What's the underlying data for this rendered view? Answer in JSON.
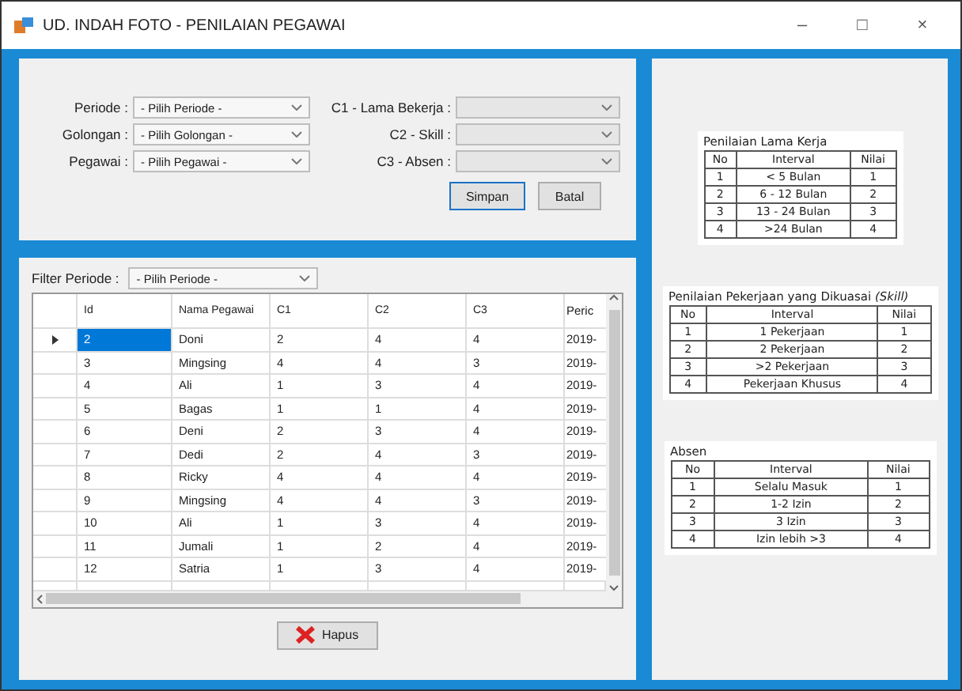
{
  "window": {
    "title": "UD. INDAH FOTO - PENILAIAN PEGAWAI",
    "controls": [
      "–",
      "□",
      "×"
    ]
  },
  "form": {
    "left_fields": [
      {
        "label": "Periode :",
        "value": "- Pilih Periode -"
      },
      {
        "label": "Golongan :",
        "value": "- Pilih Golongan -"
      },
      {
        "label": "Pegawai :",
        "value": "- Pilih Pegawai -"
      }
    ],
    "right_fields": [
      {
        "label": "C1 - Lama Bekerja :"
      },
      {
        "label": "C2 - Skill :"
      },
      {
        "label": "C3 - Absen :"
      }
    ],
    "buttons": [
      {
        "label": "Simpan",
        "focused": true
      },
      {
        "label": "Batal",
        "focused": false
      }
    ]
  },
  "grid": {
    "filter_label": "Filter Periode :",
    "filter_value": "- Pilih Periode -",
    "columns": [
      "Id",
      "Nama Pegawai",
      "C1",
      "C2",
      "C3",
      "Peric"
    ],
    "rows": [
      {
        "cells": [
          "2",
          "Doni",
          "2",
          "4",
          "4",
          "2019-"
        ],
        "selected": true
      },
      {
        "cells": [
          "3",
          "Mingsing",
          "4",
          "4",
          "3",
          "2019-"
        ],
        "selected": false
      },
      {
        "cells": [
          "4",
          "Ali",
          "1",
          "3",
          "4",
          "2019-"
        ],
        "selected": false
      },
      {
        "cells": [
          "5",
          "Bagas",
          "1",
          "1",
          "4",
          "2019-"
        ],
        "selected": false
      },
      {
        "cells": [
          "6",
          "Deni",
          "2",
          "3",
          "4",
          "2019-"
        ],
        "selected": false
      },
      {
        "cells": [
          "7",
          "Dedi",
          "2",
          "4",
          "3",
          "2019-"
        ],
        "selected": false
      },
      {
        "cells": [
          "8",
          "Ricky",
          "4",
          "4",
          "4",
          "2019-"
        ],
        "selected": false
      },
      {
        "cells": [
          "9",
          "Mingsing",
          "4",
          "4",
          "3",
          "2019-"
        ],
        "selected": false
      },
      {
        "cells": [
          "10",
          "Ali",
          "1",
          "3",
          "4",
          "2019-"
        ],
        "selected": false
      },
      {
        "cells": [
          "11",
          "Jumali",
          "1",
          "2",
          "4",
          "2019-"
        ],
        "selected": false
      },
      {
        "cells": [
          "12",
          "Satria",
          "1",
          "3",
          "4",
          "2019-"
        ],
        "selected": false
      }
    ],
    "delete_button": "Hapus"
  },
  "reference_tables": [
    {
      "title": "Penilaian Lama Kerja",
      "columns": [
        "No",
        "Interval",
        "Nilai"
      ],
      "rows": [
        [
          "1",
          "< 5 Bulan",
          "1"
        ],
        [
          "2",
          "6 - 12 Bulan",
          "2"
        ],
        [
          "3",
          "13 - 24 Bulan",
          "3"
        ],
        [
          "4",
          ">24 Bulan",
          "4"
        ]
      ]
    },
    {
      "title": "Penilaian Pekerjaan yang Dikuasai *(Skill)*",
      "columns": [
        "No",
        "Interval",
        "Nilai"
      ],
      "rows": [
        [
          "1",
          "1 Pekerjaan",
          "1"
        ],
        [
          "2",
          "2 Pekerjaan",
          "2"
        ],
        [
          "3",
          ">2 Pekerjaan",
          "3"
        ],
        [
          "4",
          "Pekerjaan Khusus",
          "4"
        ]
      ]
    },
    {
      "title": "Absen",
      "columns": [
        "No",
        "Interval",
        "Nilai"
      ],
      "rows": [
        [
          "1",
          "Selalu Masuk",
          "1"
        ],
        [
          "2",
          "1-2 Izin",
          "2"
        ],
        [
          "3",
          "3 Izin",
          "3"
        ],
        [
          "4",
          "Izin lebih >3",
          "4"
        ]
      ]
    }
  ]
}
